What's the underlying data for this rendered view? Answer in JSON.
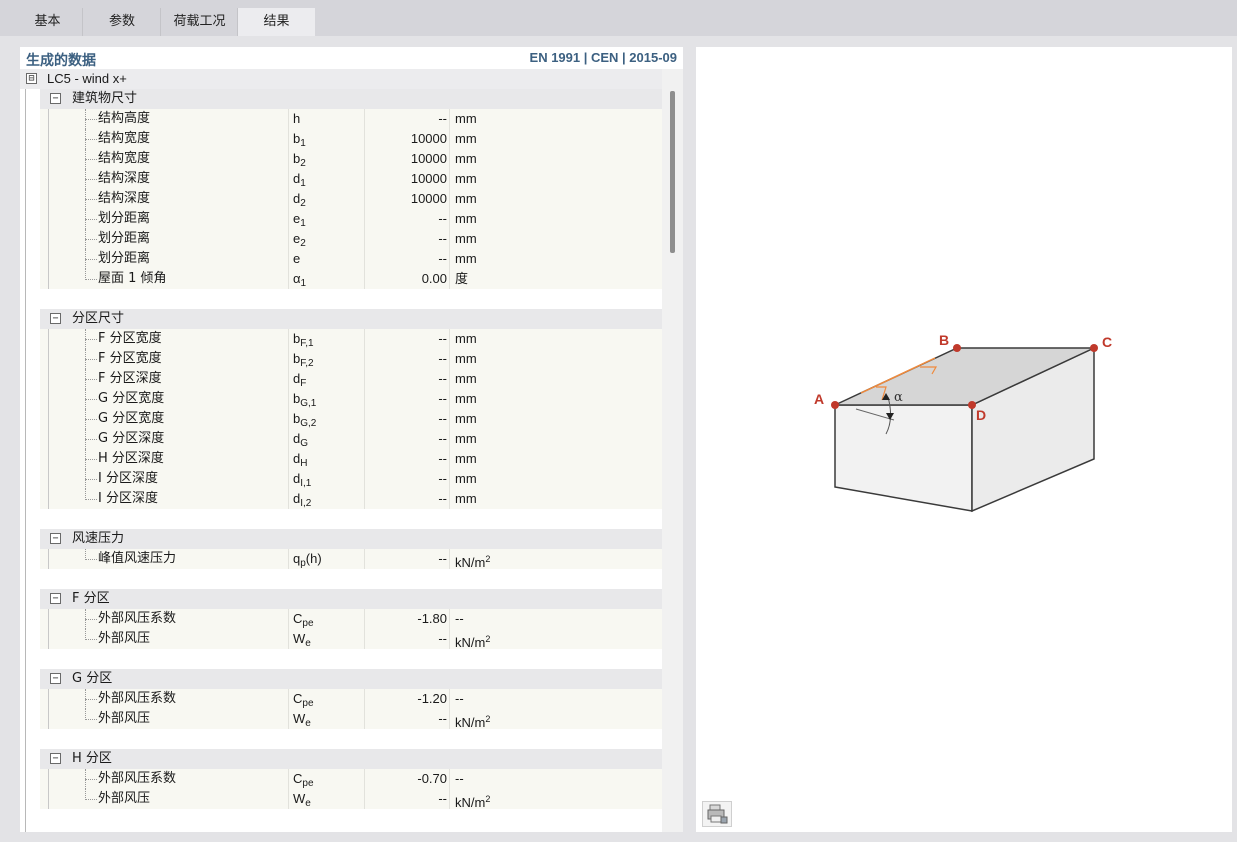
{
  "tabs": [
    {
      "label": "基本",
      "active": false
    },
    {
      "label": "参数",
      "active": false
    },
    {
      "label": "荷载工况",
      "active": false
    },
    {
      "label": "结果",
      "active": true
    }
  ],
  "panel": {
    "title": "生成的数据",
    "standard": "EN 1991 | CEN | 2015-09"
  },
  "load_case": {
    "label": "LC5 - wind x+",
    "toggle": "⊟"
  },
  "groups": [
    {
      "label": "建筑物尺寸",
      "rows": [
        {
          "name": "结构高度",
          "sym": "h",
          "sub": "",
          "val": "--",
          "unit": "mm",
          "sup": ""
        },
        {
          "name": "结构宽度",
          "sym": "b",
          "sub": "1",
          "val": "10000",
          "unit": "mm",
          "sup": ""
        },
        {
          "name": "结构宽度",
          "sym": "b",
          "sub": "2",
          "val": "10000",
          "unit": "mm",
          "sup": ""
        },
        {
          "name": "结构深度",
          "sym": "d",
          "sub": "1",
          "val": "10000",
          "unit": "mm",
          "sup": ""
        },
        {
          "name": "结构深度",
          "sym": "d",
          "sub": "2",
          "val": "10000",
          "unit": "mm",
          "sup": ""
        },
        {
          "name": "划分距离",
          "sym": "e",
          "sub": "1",
          "val": "--",
          "unit": "mm",
          "sup": ""
        },
        {
          "name": "划分距离",
          "sym": "e",
          "sub": "2",
          "val": "--",
          "unit": "mm",
          "sup": ""
        },
        {
          "name": "划分距离",
          "sym": "e",
          "sub": "",
          "val": "--",
          "unit": "mm",
          "sup": ""
        },
        {
          "name": "屋面 1 倾角",
          "sym": "α",
          "sub": "1",
          "val": "0.00",
          "unit": "度",
          "sup": ""
        }
      ]
    },
    {
      "label": "分区尺寸",
      "rows": [
        {
          "name": "F 分区宽度",
          "sym": "b",
          "sub": "F,1",
          "val": "--",
          "unit": "mm",
          "sup": ""
        },
        {
          "name": "F 分区宽度",
          "sym": "b",
          "sub": "F,2",
          "val": "--",
          "unit": "mm",
          "sup": ""
        },
        {
          "name": "F 分区深度",
          "sym": "d",
          "sub": "F",
          "val": "--",
          "unit": "mm",
          "sup": ""
        },
        {
          "name": "G 分区宽度",
          "sym": "b",
          "sub": "G,1",
          "val": "--",
          "unit": "mm",
          "sup": ""
        },
        {
          "name": "G 分区宽度",
          "sym": "b",
          "sub": "G,2",
          "val": "--",
          "unit": "mm",
          "sup": ""
        },
        {
          "name": "G 分区深度",
          "sym": "d",
          "sub": "G",
          "val": "--",
          "unit": "mm",
          "sup": ""
        },
        {
          "name": "H 分区深度",
          "sym": "d",
          "sub": "H",
          "val": "--",
          "unit": "mm",
          "sup": ""
        },
        {
          "name": "I 分区深度",
          "sym": "d",
          "sub": "I,1",
          "val": "--",
          "unit": "mm",
          "sup": ""
        },
        {
          "name": "I 分区深度",
          "sym": "d",
          "sub": "I,2",
          "val": "--",
          "unit": "mm",
          "sup": ""
        }
      ]
    },
    {
      "label": "风速压力",
      "rows": [
        {
          "name": "峰值风速压力",
          "sym": "q",
          "sub": "p",
          "sym_suffix": "(h)",
          "val": "--",
          "unit": "kN/m",
          "sup": "2"
        }
      ]
    },
    {
      "label": "F 分区",
      "rows": [
        {
          "name": "外部风压系数",
          "sym": "C",
          "sub": "pe",
          "val": "-1.80",
          "unit": "--",
          "sup": ""
        },
        {
          "name": "外部风压",
          "sym": "W",
          "sub": "e",
          "val": "--",
          "unit": "kN/m",
          "sup": "2"
        }
      ]
    },
    {
      "label": "G 分区",
      "rows": [
        {
          "name": "外部风压系数",
          "sym": "C",
          "sub": "pe",
          "val": "-1.20",
          "unit": "--",
          "sup": ""
        },
        {
          "name": "外部风压",
          "sym": "W",
          "sub": "e",
          "val": "--",
          "unit": "kN/m",
          "sup": "2"
        }
      ]
    },
    {
      "label": "H 分区",
      "rows": [
        {
          "name": "外部风压系数",
          "sym": "C",
          "sub": "pe",
          "val": "-0.70",
          "unit": "--",
          "sup": ""
        },
        {
          "name": "外部风压",
          "sym": "W",
          "sub": "e",
          "val": "--",
          "unit": "kN/m",
          "sup": "2"
        }
      ]
    }
  ],
  "diagram": {
    "points": {
      "A": "A",
      "B": "B",
      "C": "C",
      "D": "D"
    },
    "angle_label": "α",
    "colors": {
      "edge": "#3a3a3a",
      "roof": "#d6d6d6",
      "front": "#f2f2f2",
      "side": "#ebebeb",
      "point": "#c0392b",
      "label": "#c0392b",
      "highlight": "#f08a3c"
    }
  },
  "toolbar": {
    "icon": "print-icon"
  }
}
